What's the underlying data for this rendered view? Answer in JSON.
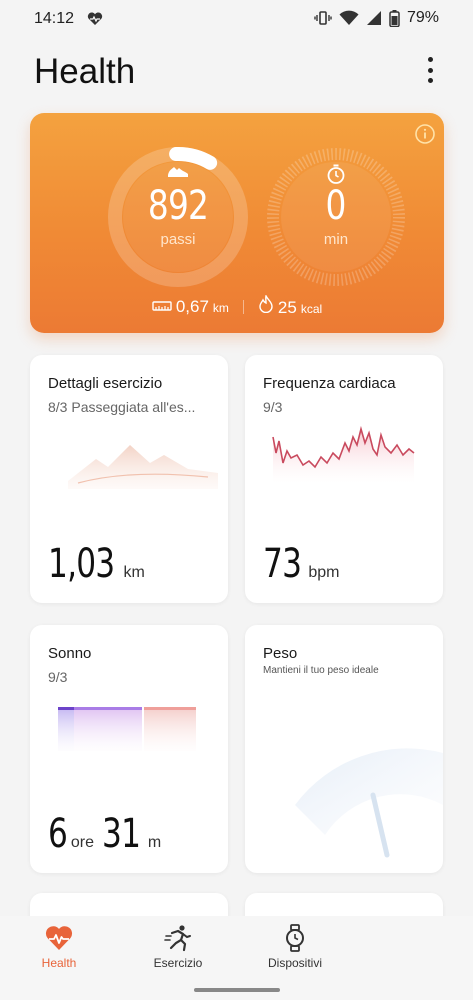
{
  "status_bar": {
    "time": "14:12",
    "battery": "79%",
    "icons": [
      "heart-status-icon",
      "vibrate-icon",
      "wifi-icon",
      "signal-icon",
      "battery-icon"
    ]
  },
  "header": {
    "title": "Health"
  },
  "activity": {
    "steps": "892",
    "steps_label": "passi",
    "minutes": "0",
    "minutes_label": "min",
    "distance": "0,67",
    "distance_unit": "km",
    "calories": "25",
    "calories_unit": "kcal",
    "steps_goal_fraction": 0.09
  },
  "tiles": {
    "exercise": {
      "title": "Dettagli esercizio",
      "subtitle": "8/3 Passeggiata all'es...",
      "value": "1,03",
      "unit": "km"
    },
    "heart_rate": {
      "title": "Frequenza cardiaca",
      "subtitle": "9/3",
      "value": "73",
      "unit": "bpm"
    },
    "sleep": {
      "title": "Sonno",
      "subtitle": "9/3",
      "hours": "6",
      "hours_unit": "ore",
      "minutes": "31",
      "minutes_unit": "m"
    },
    "weight": {
      "title": "Peso",
      "subtitle": "Mantieni il tuo peso ideale"
    }
  },
  "nav": {
    "items": [
      {
        "label": "Health",
        "icon": "heart-pulse-icon",
        "active": true
      },
      {
        "label": "Esercizio",
        "icon": "running-icon",
        "active": false
      },
      {
        "label": "Dispositivi",
        "icon": "watch-icon",
        "active": false
      }
    ]
  },
  "colors": {
    "accent": "#e8643a",
    "card_orange": "#f08a35",
    "heart_line": "#c94a5e",
    "sleep_purple": "#8e5be0"
  }
}
